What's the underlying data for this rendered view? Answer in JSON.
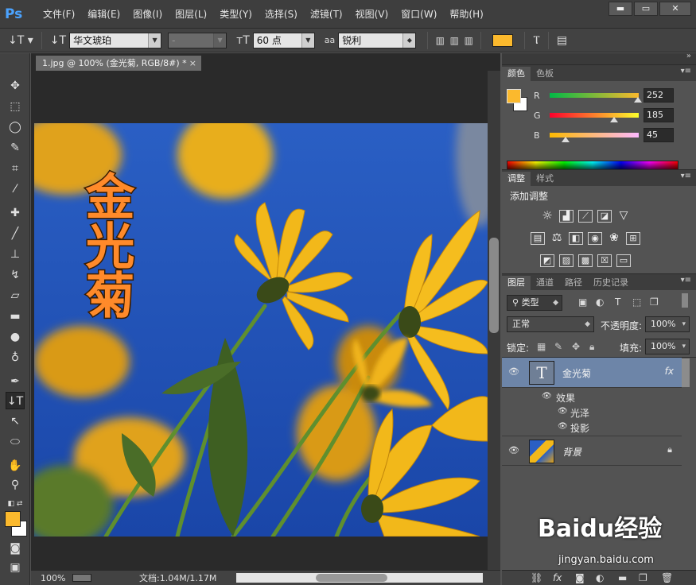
{
  "app": {
    "logo": "Ps",
    "menus": [
      "文件(F)",
      "编辑(E)",
      "图像(I)",
      "图层(L)",
      "类型(Y)",
      "选择(S)",
      "滤镜(T)",
      "视图(V)",
      "窗口(W)",
      "帮助(H)"
    ],
    "window_controls": [
      "▬",
      "▭",
      "✕"
    ]
  },
  "options_bar": {
    "font_family": "华文琥珀",
    "font_style": "-",
    "font_size": "60 点",
    "antialias_label": "aa",
    "antialias": "锐利",
    "text_color": "#fbb92d"
  },
  "document": {
    "tab_title": "1.jpg @ 100% (金光菊, RGB/8#) *",
    "tab_close": "×",
    "canvas_text": "金光菊"
  },
  "status": {
    "zoom": "100%",
    "doc_size": "文档:1.04M/1.17M"
  },
  "colors": {
    "foreground": "#fbb92d",
    "background": "#ffffff"
  },
  "color_panel": {
    "tabs": [
      "颜色",
      "色板"
    ],
    "r": {
      "label": "R",
      "value": "252",
      "fraction": 0.988
    },
    "g": {
      "label": "G",
      "value": "185",
      "fraction": 0.725
    },
    "b": {
      "label": "B",
      "value": "45",
      "fraction": 0.176
    }
  },
  "adjust_panel": {
    "tabs": [
      "调整",
      "样式"
    ],
    "title": "添加调整",
    "icons_row1": [
      "brightness-icon",
      "levels-icon",
      "curves-icon",
      "exposure-icon",
      "vibrance-icon"
    ],
    "icons_row2": [
      "hue-sat-icon",
      "color-balance-icon",
      "bw-icon",
      "photo-filter-icon",
      "channel-mixer-icon",
      "color-lookup-icon"
    ],
    "icons_row3": [
      "invert-icon",
      "posterize-icon",
      "threshold-icon",
      "selective-color-icon",
      "gradient-map-icon"
    ]
  },
  "layers_panel": {
    "tabs": [
      "图层",
      "通道",
      "路径",
      "历史记录"
    ],
    "filter_kind": "类型",
    "blend_mode": "正常",
    "opacity_label": "不透明度:",
    "opacity": "100%",
    "lock_label": "锁定:",
    "fill_label": "填充:",
    "fill": "100%",
    "layers": [
      {
        "name": "金光菊",
        "type": "text",
        "fx": "fx",
        "selected": true
      },
      {
        "name": "背景",
        "type": "image",
        "locked": true,
        "selected": false
      }
    ],
    "effects_label": "效果",
    "effects": [
      "光泽",
      "投影"
    ]
  },
  "watermark": {
    "brand": "Baidu经验",
    "url": "jingyan.baidu.com"
  }
}
